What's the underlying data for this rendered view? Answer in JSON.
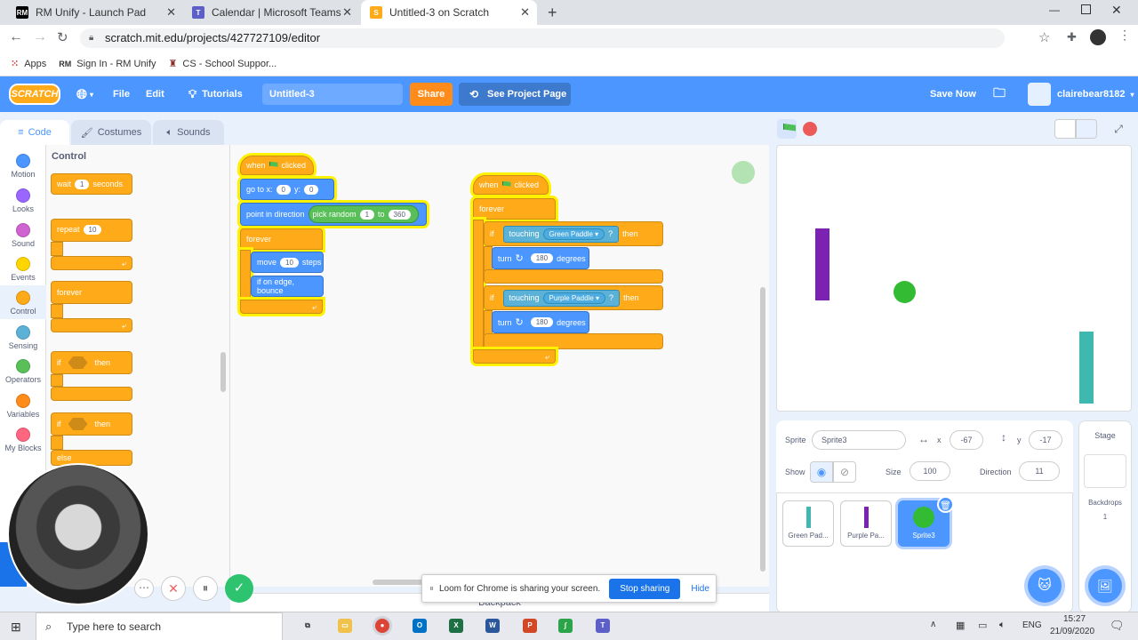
{
  "browser": {
    "tabs": [
      {
        "title": "RM Unify - Launch Pad",
        "icon": "rm-icon"
      },
      {
        "title": "Calendar | Microsoft Teams",
        "icon": "teams-icon"
      },
      {
        "title": "Untitled-3 on Scratch",
        "icon": "scratch-icon"
      }
    ],
    "url": "scratch.mit.edu/projects/427727109/editor",
    "bookmarks": [
      "Apps",
      "Sign In - RM Unify",
      "CS - School Suppor..."
    ]
  },
  "menu": {
    "logo": "SCRATCH",
    "file": "File",
    "edit": "Edit",
    "tutorials": "Tutorials",
    "project_title": "Untitled-3",
    "share": "Share",
    "see_project": "See Project Page",
    "save_now": "Save Now",
    "username": "clairebear8182"
  },
  "editor_tabs": {
    "code": "Code",
    "costumes": "Costumes",
    "sounds": "Sounds"
  },
  "categories": [
    {
      "label": "Motion",
      "color": "#4c97ff"
    },
    {
      "label": "Looks",
      "color": "#9966ff"
    },
    {
      "label": "Sound",
      "color": "#cf63cf"
    },
    {
      "label": "Events",
      "color": "#ffd500"
    },
    {
      "label": "Control",
      "color": "#ffab19"
    },
    {
      "label": "Sensing",
      "color": "#5cb1d6"
    },
    {
      "label": "Operators",
      "color": "#59c059"
    },
    {
      "label": "Variables",
      "color": "#ff8c1a"
    },
    {
      "label": "My Blocks",
      "color": "#ff6680"
    }
  ],
  "palette": {
    "heading": "Control",
    "wait": "wait",
    "wait_val": "1",
    "seconds": "seconds",
    "repeat": "repeat",
    "repeat_val": "10",
    "forever": "forever",
    "if": "if",
    "then": "then",
    "if2": "if",
    "then2": "then",
    "else": "else"
  },
  "script1": {
    "when": "when",
    "clicked": "clicked",
    "goto": "go to x:",
    "x": "0",
    "y_label": "y:",
    "y": "0",
    "point": "point in direction",
    "pick": "pick random",
    "from": "1",
    "to": "to",
    "to_val": "360",
    "forever": "forever",
    "move": "move",
    "steps_val": "10",
    "steps": "steps",
    "bounce": "if on edge, bounce"
  },
  "script2": {
    "when": "when",
    "clicked": "clicked",
    "forever": "forever",
    "if1": "if",
    "touching1": "touching",
    "target1": "Green Paddle",
    "q1": "?",
    "then1": "then",
    "turn1": "turn",
    "deg1_val": "180",
    "degrees1": "degrees",
    "if2": "if",
    "touching2": "touching",
    "target2": "Purple Paddle",
    "q2": "?",
    "then2": "then",
    "turn2": "turn",
    "deg2_val": "180",
    "degrees2": "degrees"
  },
  "zoom": {
    "in": "+",
    "out": "−",
    "reset": "="
  },
  "sprite_info": {
    "sprite_label": "Sprite",
    "sprite_name": "Sprite3",
    "x_label": "x",
    "x": "-67",
    "y_label": "y",
    "y": "-17",
    "show_label": "Show",
    "size_label": "Size",
    "size": "100",
    "direction_label": "Direction",
    "direction": "11"
  },
  "sprites": [
    {
      "name": "Green Pad...",
      "color": "#3fb8af"
    },
    {
      "name": "Purple Pa...",
      "color": "#7b22b3"
    },
    {
      "name": "Sprite3",
      "color": "#33bb33"
    }
  ],
  "stage_panel": {
    "title": "Stage",
    "backdrops": "Backdrops",
    "count": "1"
  },
  "backpack": "Backpack",
  "loom": {
    "message": "Loom for Chrome is sharing your screen.",
    "stop": "Stop sharing",
    "hide": "Hide"
  },
  "taskbar": {
    "search": "Type here to search",
    "lang": "ENG",
    "time": "15:27",
    "date": "21/09/2020"
  }
}
